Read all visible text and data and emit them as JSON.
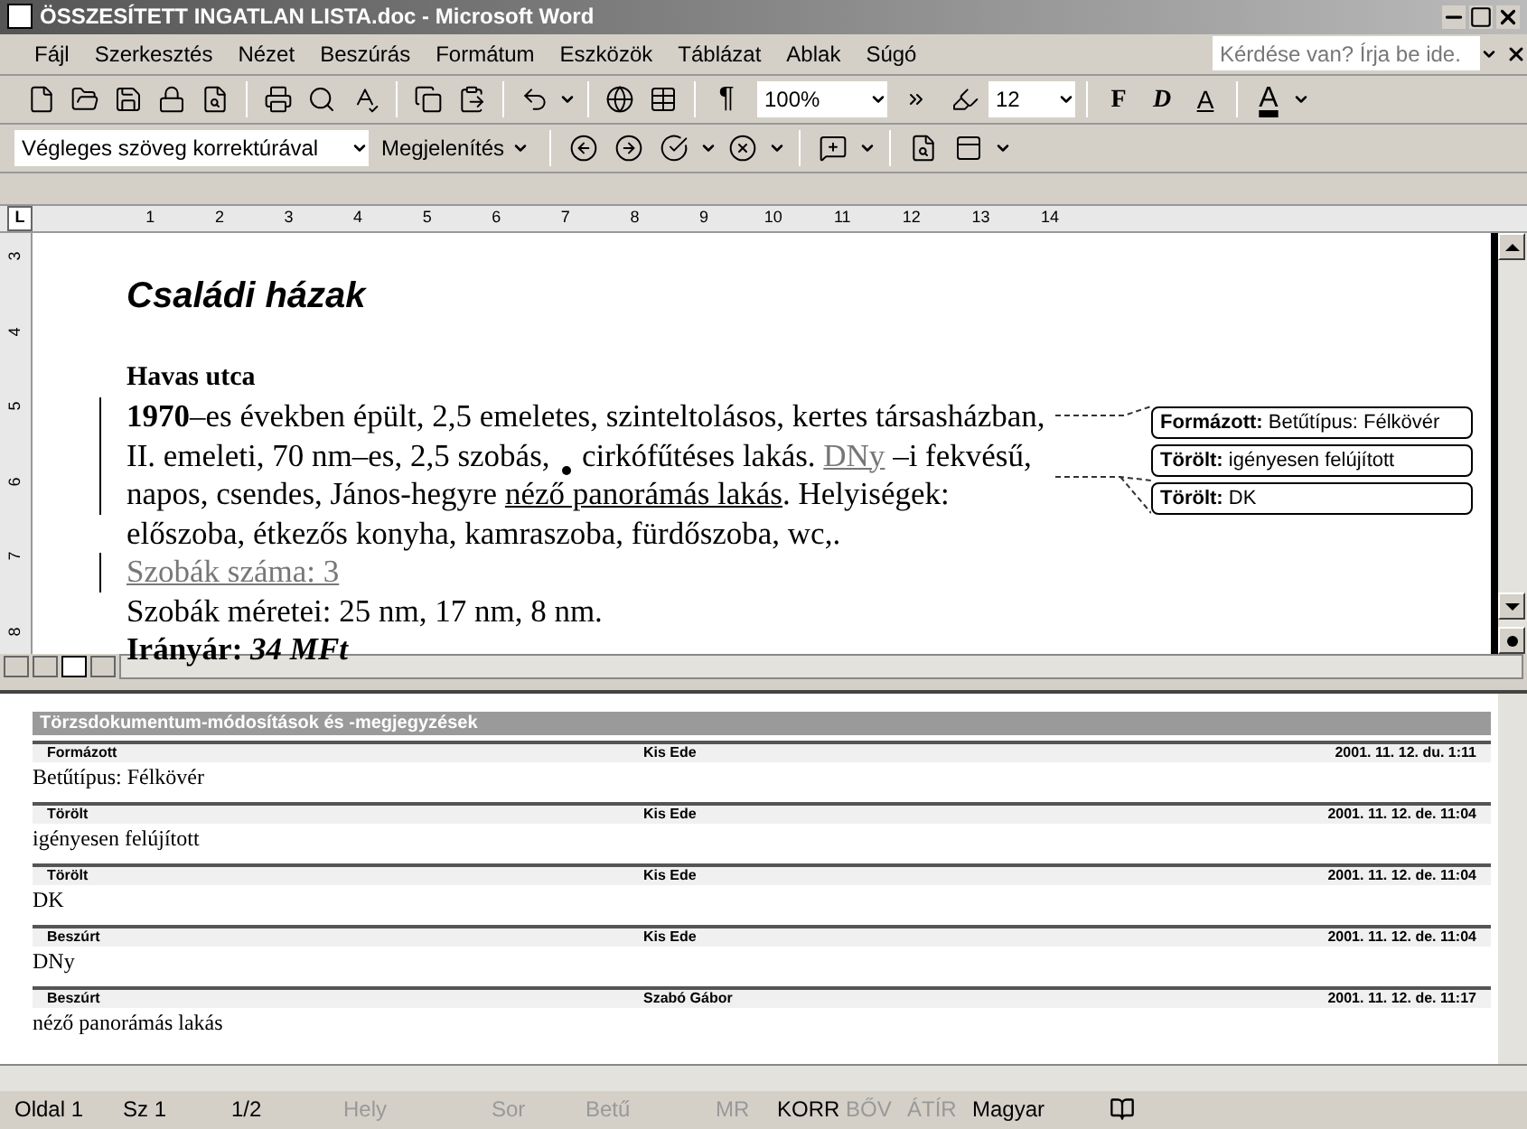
{
  "window": {
    "title": "ÖSSZESÍTETT INGATLAN LISTA.doc - Microsoft Word"
  },
  "menu": [
    "Fájl",
    "Szerkesztés",
    "Nézet",
    "Beszúrás",
    "Formátum",
    "Eszközök",
    "Táblázat",
    "Ablak",
    "Súgó"
  ],
  "help_box": {
    "placeholder": "Kérdése van? Írja be ide."
  },
  "standard_toolbar": {
    "zoom": "100%",
    "pilcrow": "¶",
    "font_size": "12",
    "format_buttons": [
      {
        "text": "F",
        "kind": "bold"
      },
      {
        "text": "D",
        "kind": "italic"
      },
      {
        "text": "A",
        "kind": "underline"
      }
    ],
    "font_color": "A"
  },
  "reviewing_toolbar": {
    "view": "Végleges szöveg korrektúrával",
    "show_button": "Megjelenítés"
  },
  "ruler": {
    "tab_selector": "L",
    "horizontal": [
      "1",
      "2",
      "3",
      "4",
      "5",
      "6",
      "7",
      "8",
      "9",
      "10",
      "11",
      "12",
      "13",
      "14"
    ],
    "vertical": [
      "3",
      "4",
      "5",
      "6",
      "7",
      "8"
    ]
  },
  "document": {
    "heading": "Családi házak",
    "subheading": "Havas utca",
    "lines": [
      {
        "changed": true,
        "segments": [
          {
            "text": "1970",
            "kind": "bold"
          },
          {
            "text": "–es években épült, 2,5 emeletes, szinteltolásos, kertes társasházban,",
            "kind": "plain"
          }
        ]
      },
      {
        "changed": true,
        "segments": [
          {
            "text": "II. emeleti, 70 nm–es, 2,5 szobás, ",
            "kind": "plain"
          },
          {
            "kind": "deletion"
          },
          {
            "text": " cirkófűtéses lakás. ",
            "kind": "plain"
          },
          {
            "text": "DNy",
            "kind": "inserted"
          },
          {
            "text": " –i fekvésű,",
            "kind": "plain"
          }
        ]
      },
      {
        "changed": true,
        "segments": [
          {
            "text": "napos, csendes, János-hegyre ",
            "kind": "plain"
          },
          {
            "text": "néző panorámás lakás",
            "kind": "underlined"
          },
          {
            "text": ". Helyiségek:",
            "kind": "plain"
          }
        ]
      },
      {
        "changed": false,
        "segments": [
          {
            "text": "előszoba, étkezős konyha, kamraszoba, fürdőszoba, wc,.",
            "kind": "plain"
          }
        ]
      },
      {
        "changed": true,
        "segments": [
          {
            "text": "Szobák száma: 3",
            "kind": "inserted"
          }
        ]
      },
      {
        "changed": false,
        "segments": [
          {
            "text": "Szobák méretei: 25 nm, 17 nm, 8 nm.",
            "kind": "plain"
          }
        ]
      },
      {
        "changed": false,
        "segments": [
          {
            "text": "Irányár: ",
            "kind": "bold"
          },
          {
            "text": "34 MFt",
            "kind": "bolditalic"
          }
        ]
      }
    ],
    "balloons": [
      {
        "label": "Formázott:",
        "text": "Betűtípus: Félkövér"
      },
      {
        "label": "Törölt:",
        "text": "igényesen felújított"
      },
      {
        "label": "Törölt:",
        "text": "DK"
      }
    ]
  },
  "reviewing_pane": {
    "title": "Törzsdokumentum-módosítások és -megjegyzések",
    "entries": [
      {
        "type": "Formázott",
        "author": "Kis Ede",
        "date": "2001. 11. 12. du. 1:11",
        "text": "Betűtípus: Félkövér"
      },
      {
        "type": "Törölt",
        "author": "Kis Ede",
        "date": "2001. 11. 12. de. 11:04",
        "text": "igényesen felújított"
      },
      {
        "type": "Törölt",
        "author": "Kis Ede",
        "date": "2001. 11. 12. de. 11:04",
        "text": "DK"
      },
      {
        "type": "Beszúrt",
        "author": "Kis Ede",
        "date": "2001. 11. 12. de. 11:04",
        "text": "DNy"
      },
      {
        "type": "Beszúrt",
        "author": "Szabó Gábor",
        "date": "2001. 11. 12. de. 11:17",
        "text": "néző panorámás lakás"
      }
    ]
  },
  "status_bar": [
    {
      "text": "Oldal 1",
      "disabled": false
    },
    {
      "text": "Sz 1",
      "disabled": false
    },
    {
      "text": "1/2",
      "disabled": false
    },
    {
      "text": "Hely",
      "disabled": true
    },
    {
      "text": "Sor",
      "disabled": true
    },
    {
      "text": "Betű",
      "disabled": true
    },
    {
      "text": "MR",
      "disabled": true
    },
    {
      "text": "KORR",
      "disabled": false
    },
    {
      "text": "BŐV",
      "disabled": true
    },
    {
      "text": "ÁTÍR",
      "disabled": true
    },
    {
      "text": "Magyar",
      "disabled": false
    }
  ]
}
